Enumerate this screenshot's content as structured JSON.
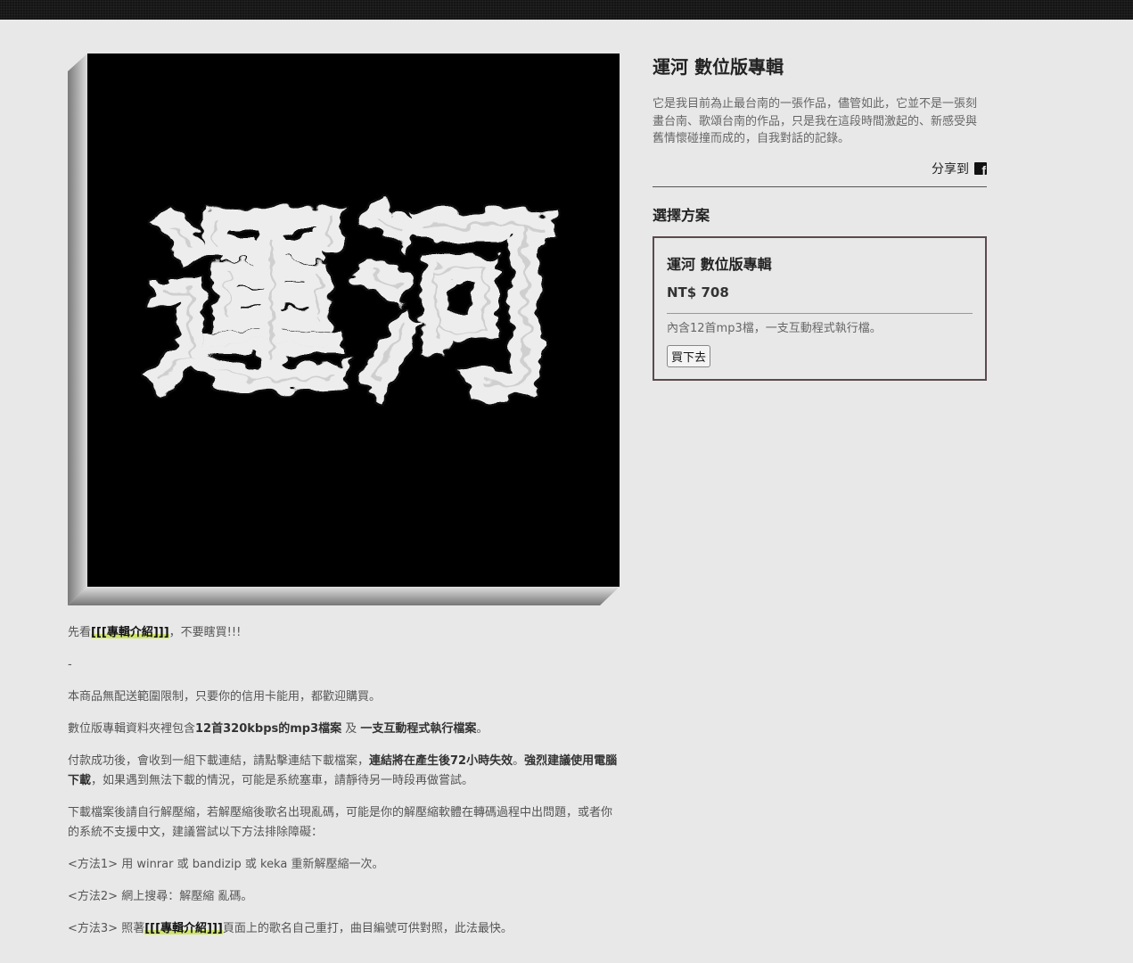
{
  "cover": {
    "characters": "運河"
  },
  "product": {
    "title": "運河 數位版專輯",
    "summary": "它是我目前為止最台南的一張作品，儘管如此，它並不是一張刻畫台南、歌頌台南的作品，只是我在這段時間激起的、新感受與舊情懷碰撞而成的，自我對話的記錄。",
    "share_label": "分享到",
    "share_icon": "facebook-icon"
  },
  "plans": {
    "section_title": "選擇方案",
    "items": [
      {
        "name": "運河 數位版專輯",
        "price": "NT$ 708",
        "note": "內含12首mp3檔，一支互動程式執行檔。",
        "buy_label": "買下去"
      }
    ]
  },
  "description": {
    "p1": {
      "pre": "先看",
      "link": "[[[專輯介紹]]]",
      "post": "，不要瞎買!!!"
    },
    "p2": "-",
    "p3": "本商品無配送範圍限制，只要你的信用卡能用，都歡迎購買。",
    "p4": {
      "pre": "數位版專輯資料夾裡包含",
      "b1": "12首320kbps的mp3檔案",
      "mid": " 及 ",
      "b2": "一支互動程式執行檔案",
      "post": "。"
    },
    "p5": {
      "pre": "付款成功後，會收到一組下載連結，請點擊連結下載檔案，",
      "b1": "連結將在產生後72小時失效",
      "mid": "。",
      "b2": "強烈建議使用電腦下載",
      "post": "，如果遇到無法下載的情況，可能是系統塞車，請靜待另一時段再做嘗試。"
    },
    "p6": "下載檔案後請自行解壓縮，若解壓縮後歌名出現亂碼，可能是你的解壓縮軟體在轉碼過程中出問題，或者你的系統不支援中文，建議嘗試以下方法排除障礙：",
    "p7": "<方法1> 用 winrar 或 bandizip 或 keka 重新解壓縮一次。",
    "p8": "<方法2> 網上搜尋：解壓縮 亂碼。",
    "p9": {
      "pre": "<方法3> 照著",
      "link": "[[[專輯介紹]]]",
      "post": "頁面上的歌名自己重打，曲目編號可供對照，此法最快。"
    }
  }
}
